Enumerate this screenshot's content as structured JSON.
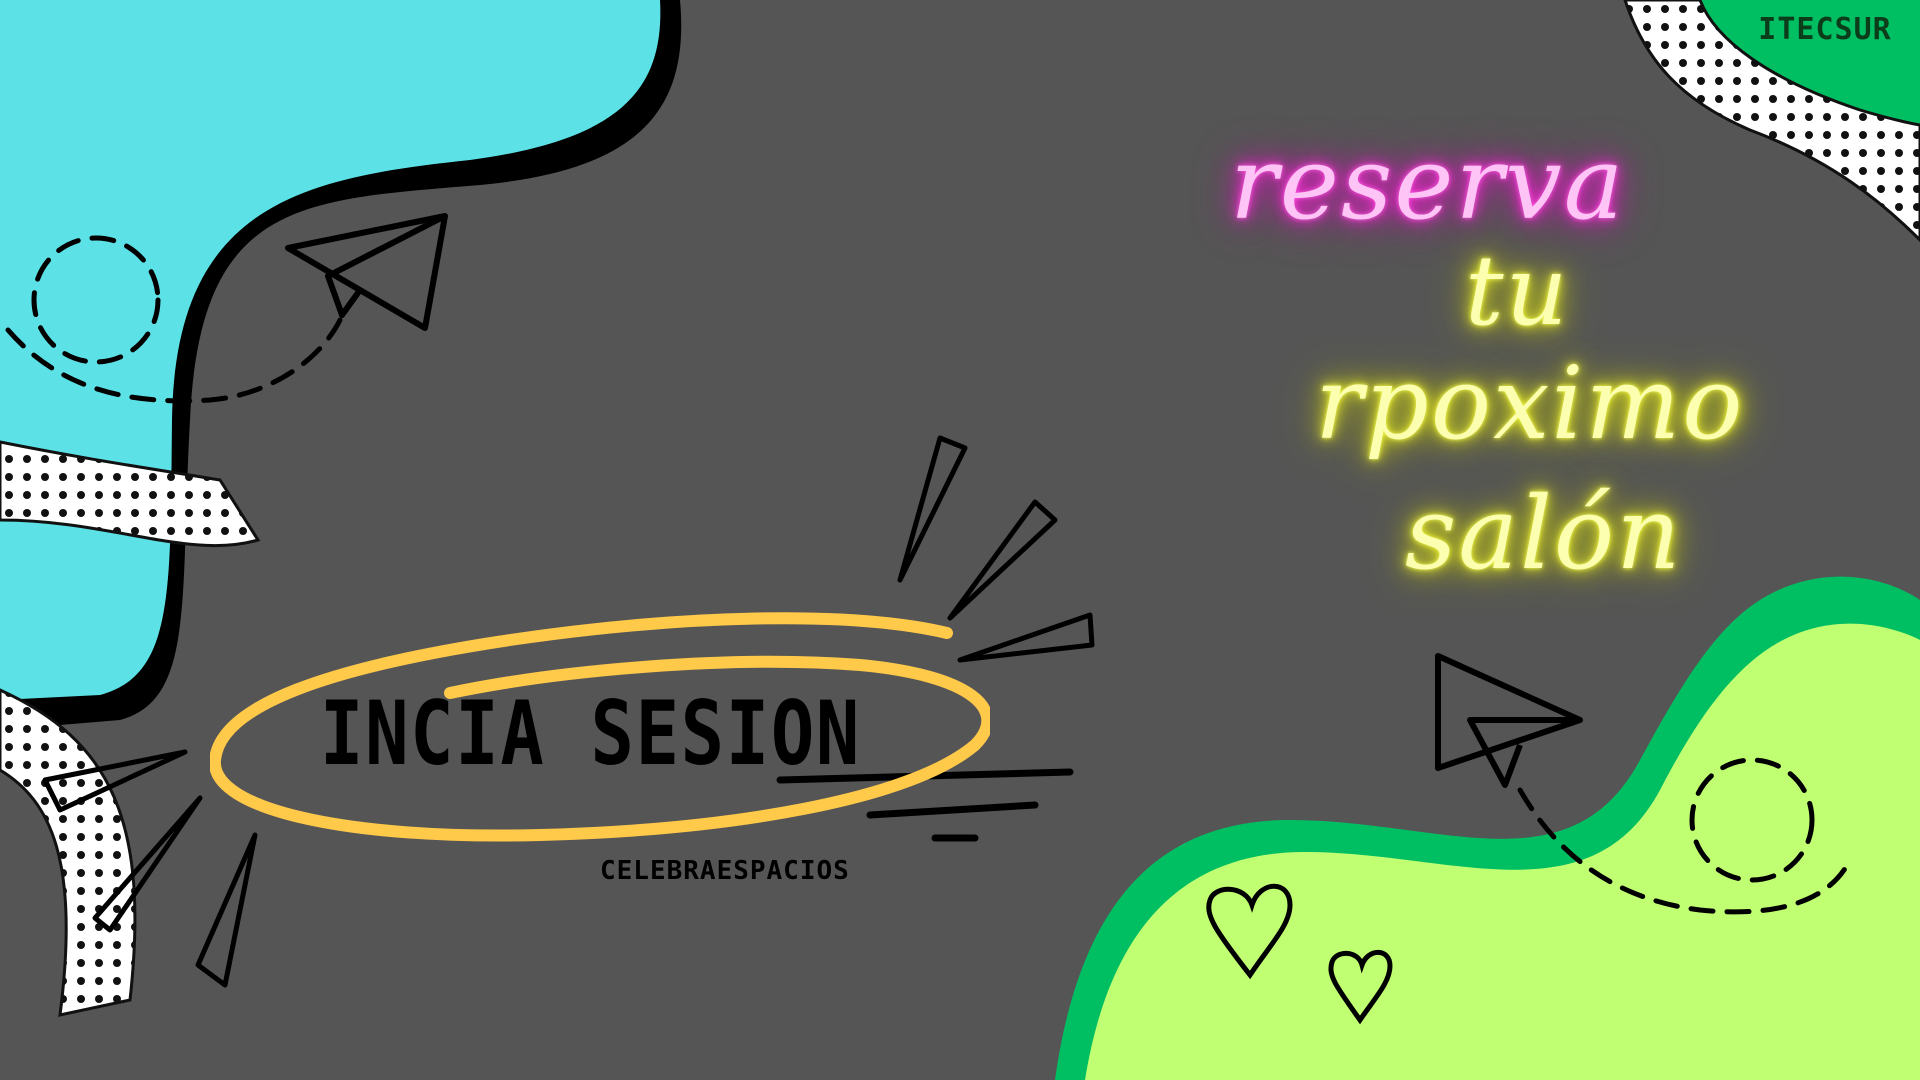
{
  "brand": {
    "label": "ITECSUR"
  },
  "headline": {
    "line1": "reserva",
    "line2": "tu",
    "line3": "rpoximo",
    "line4": "salón"
  },
  "login": {
    "label": "INCIA SESION"
  },
  "subtitle": "CELEBRAESPACIOS",
  "colors": {
    "background": "#555555",
    "cyan_blob": "#5ce1e6",
    "green_dark": "#00bf63",
    "green_light": "#c1ff72",
    "neon_pink": "#ff4fe0",
    "neon_yellow": "#f4ff5a",
    "highlight_oval": "#ffc94a"
  }
}
